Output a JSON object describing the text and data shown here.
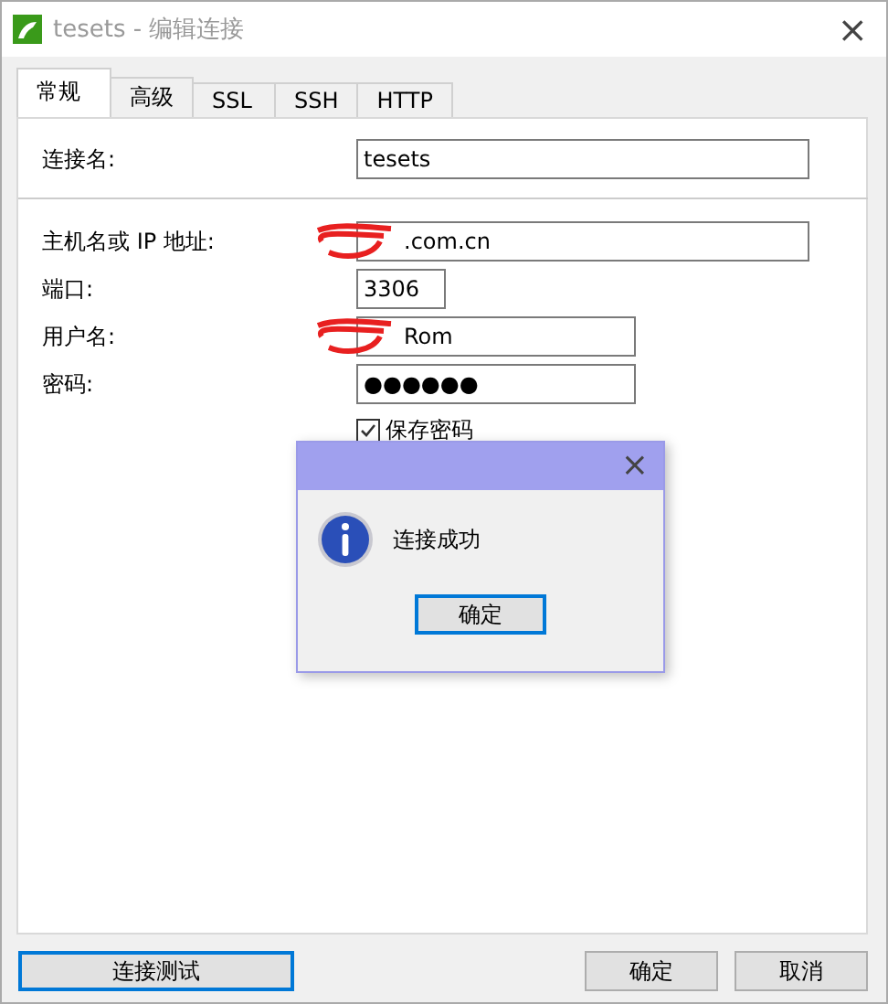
{
  "window": {
    "title": "tesets - 编辑连接",
    "close": "×"
  },
  "tabs": [
    {
      "label": "常规",
      "selected": true
    },
    {
      "label": "高级",
      "selected": false
    },
    {
      "label": "SSL",
      "selected": false
    },
    {
      "label": "SSH",
      "selected": false
    },
    {
      "label": "HTTP",
      "selected": false
    }
  ],
  "sections": [
    {
      "fields": [
        {
          "label": "连接名:",
          "value": "tesets",
          "redacted": false
        }
      ]
    },
    {
      "fields": [
        {
          "label": "主机名或 IP 地址:",
          "value": ".com.cn",
          "redacted": true
        },
        {
          "label": "端口:",
          "value": "3306",
          "redacted": false
        },
        {
          "label": "用户名:",
          "value": "Rom",
          "redacted": true
        },
        {
          "label": "密码:",
          "value": "●●●●●●",
          "redacted": false
        }
      ]
    }
  ],
  "save_password": {
    "label": "保存密码",
    "checked": true
  },
  "dialog": {
    "message": "连接成功",
    "button": "确定",
    "close": "×"
  },
  "buttons": [
    {
      "label": "连接测试",
      "focused": true
    },
    {
      "label": "确定",
      "focused": false
    },
    {
      "label": "取消",
      "focused": false
    }
  ]
}
